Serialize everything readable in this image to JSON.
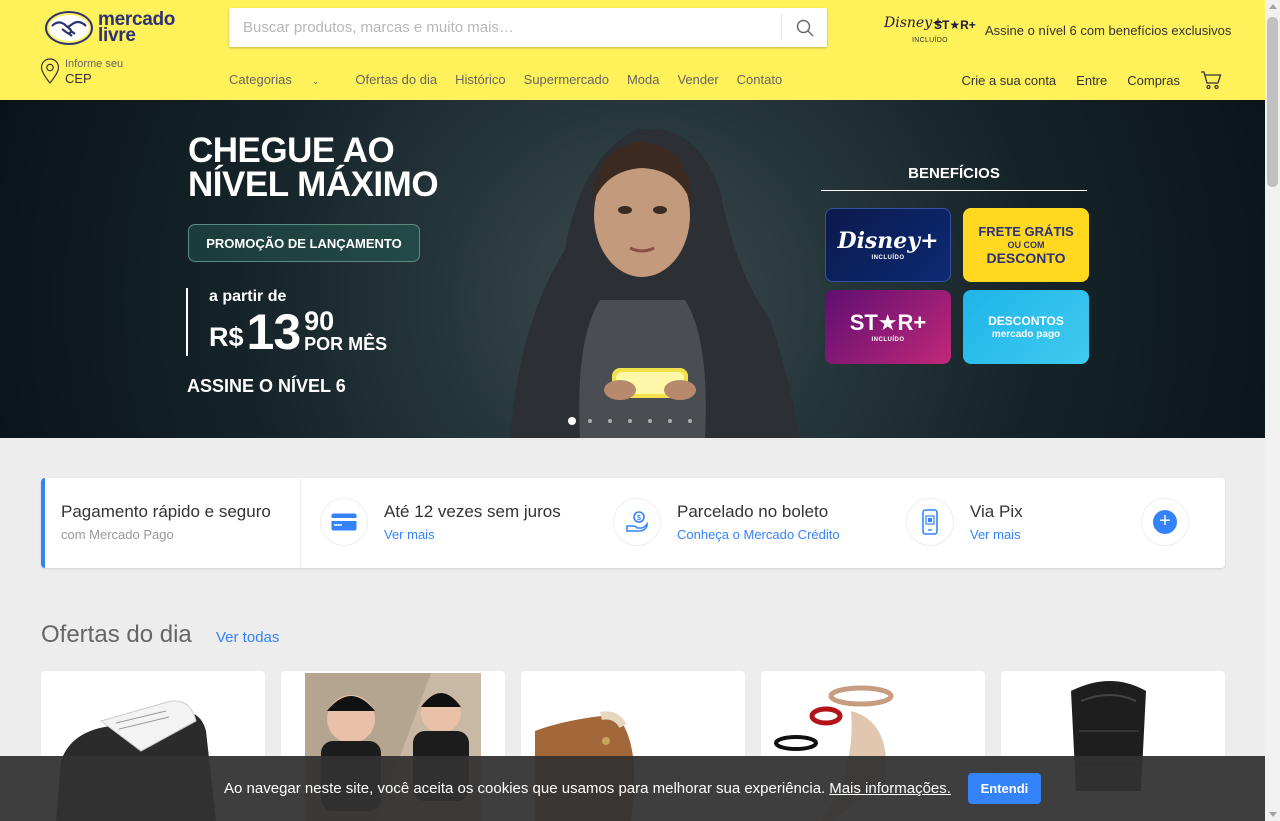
{
  "header": {
    "logo_line1": "mercado",
    "logo_line2": "livre",
    "search_placeholder": "Buscar produtos, marcas e muito mais…",
    "promo_disney": "Disney+",
    "promo_star": "ST★R+",
    "promo_included": "INCLUÍDO",
    "promo_text": "Assine o nível 6 com benefícios exclusivos",
    "cep_label": "Informe seu",
    "cep_value": "CEP",
    "nav": [
      "Categorias",
      "Ofertas do dia",
      "Histórico",
      "Supermercado",
      "Moda",
      "Vender",
      "Contato"
    ],
    "user_nav": [
      "Crie a sua conta",
      "Entre",
      "Compras"
    ],
    "brand_color": "#fff159"
  },
  "hero": {
    "title_line1": "CHEGUE AO",
    "title_line2": "NÍVEL MÁXIMO",
    "pill": "PROMOÇÃO DE LANÇAMENTO",
    "price_from": "a partir de",
    "price_currency": "R$",
    "price_int": "13",
    "price_dec": "90",
    "price_period": "POR MÊS",
    "cta": "ASSINE O NÍVEL 6",
    "benefits_title": "BENEFÍCIOS",
    "tile_disney": "Disney+",
    "tile_disney_sub": "INCLUÍDO",
    "tile_frete_1": "FRETE GRÁTIS",
    "tile_frete_2": "OU COM",
    "tile_frete_3": "DESCONTO",
    "tile_star": "ST★R+",
    "tile_star_sub": "INCLUÍDO",
    "tile_desc_1": "DESCONTOS",
    "tile_desc_2": "mercado pago",
    "carousel_active": 1,
    "carousel_total": 7
  },
  "payment": {
    "first_title": "Pagamento rápido e seguro",
    "first_sub": "com Mercado Pago",
    "items": [
      {
        "title": "Até 12 vezes sem juros",
        "link": "Ver mais",
        "icon": "credit-card-icon"
      },
      {
        "title": "Parcelado no boleto",
        "link": "Conheça o Mercado Crédito",
        "icon": "hand-coin-icon"
      },
      {
        "title": "Via Pix",
        "link": "Ver mais",
        "icon": "phone-pix-icon"
      }
    ],
    "accent": "#3483fa"
  },
  "offers": {
    "title": "Ofertas do dia",
    "link": "Ver todas"
  },
  "cookie": {
    "text": "Ao navegar neste site, você aceita os cookies que usamos para melhorar sua experiência.",
    "link": "Mais informações.",
    "button": "Entendi"
  }
}
